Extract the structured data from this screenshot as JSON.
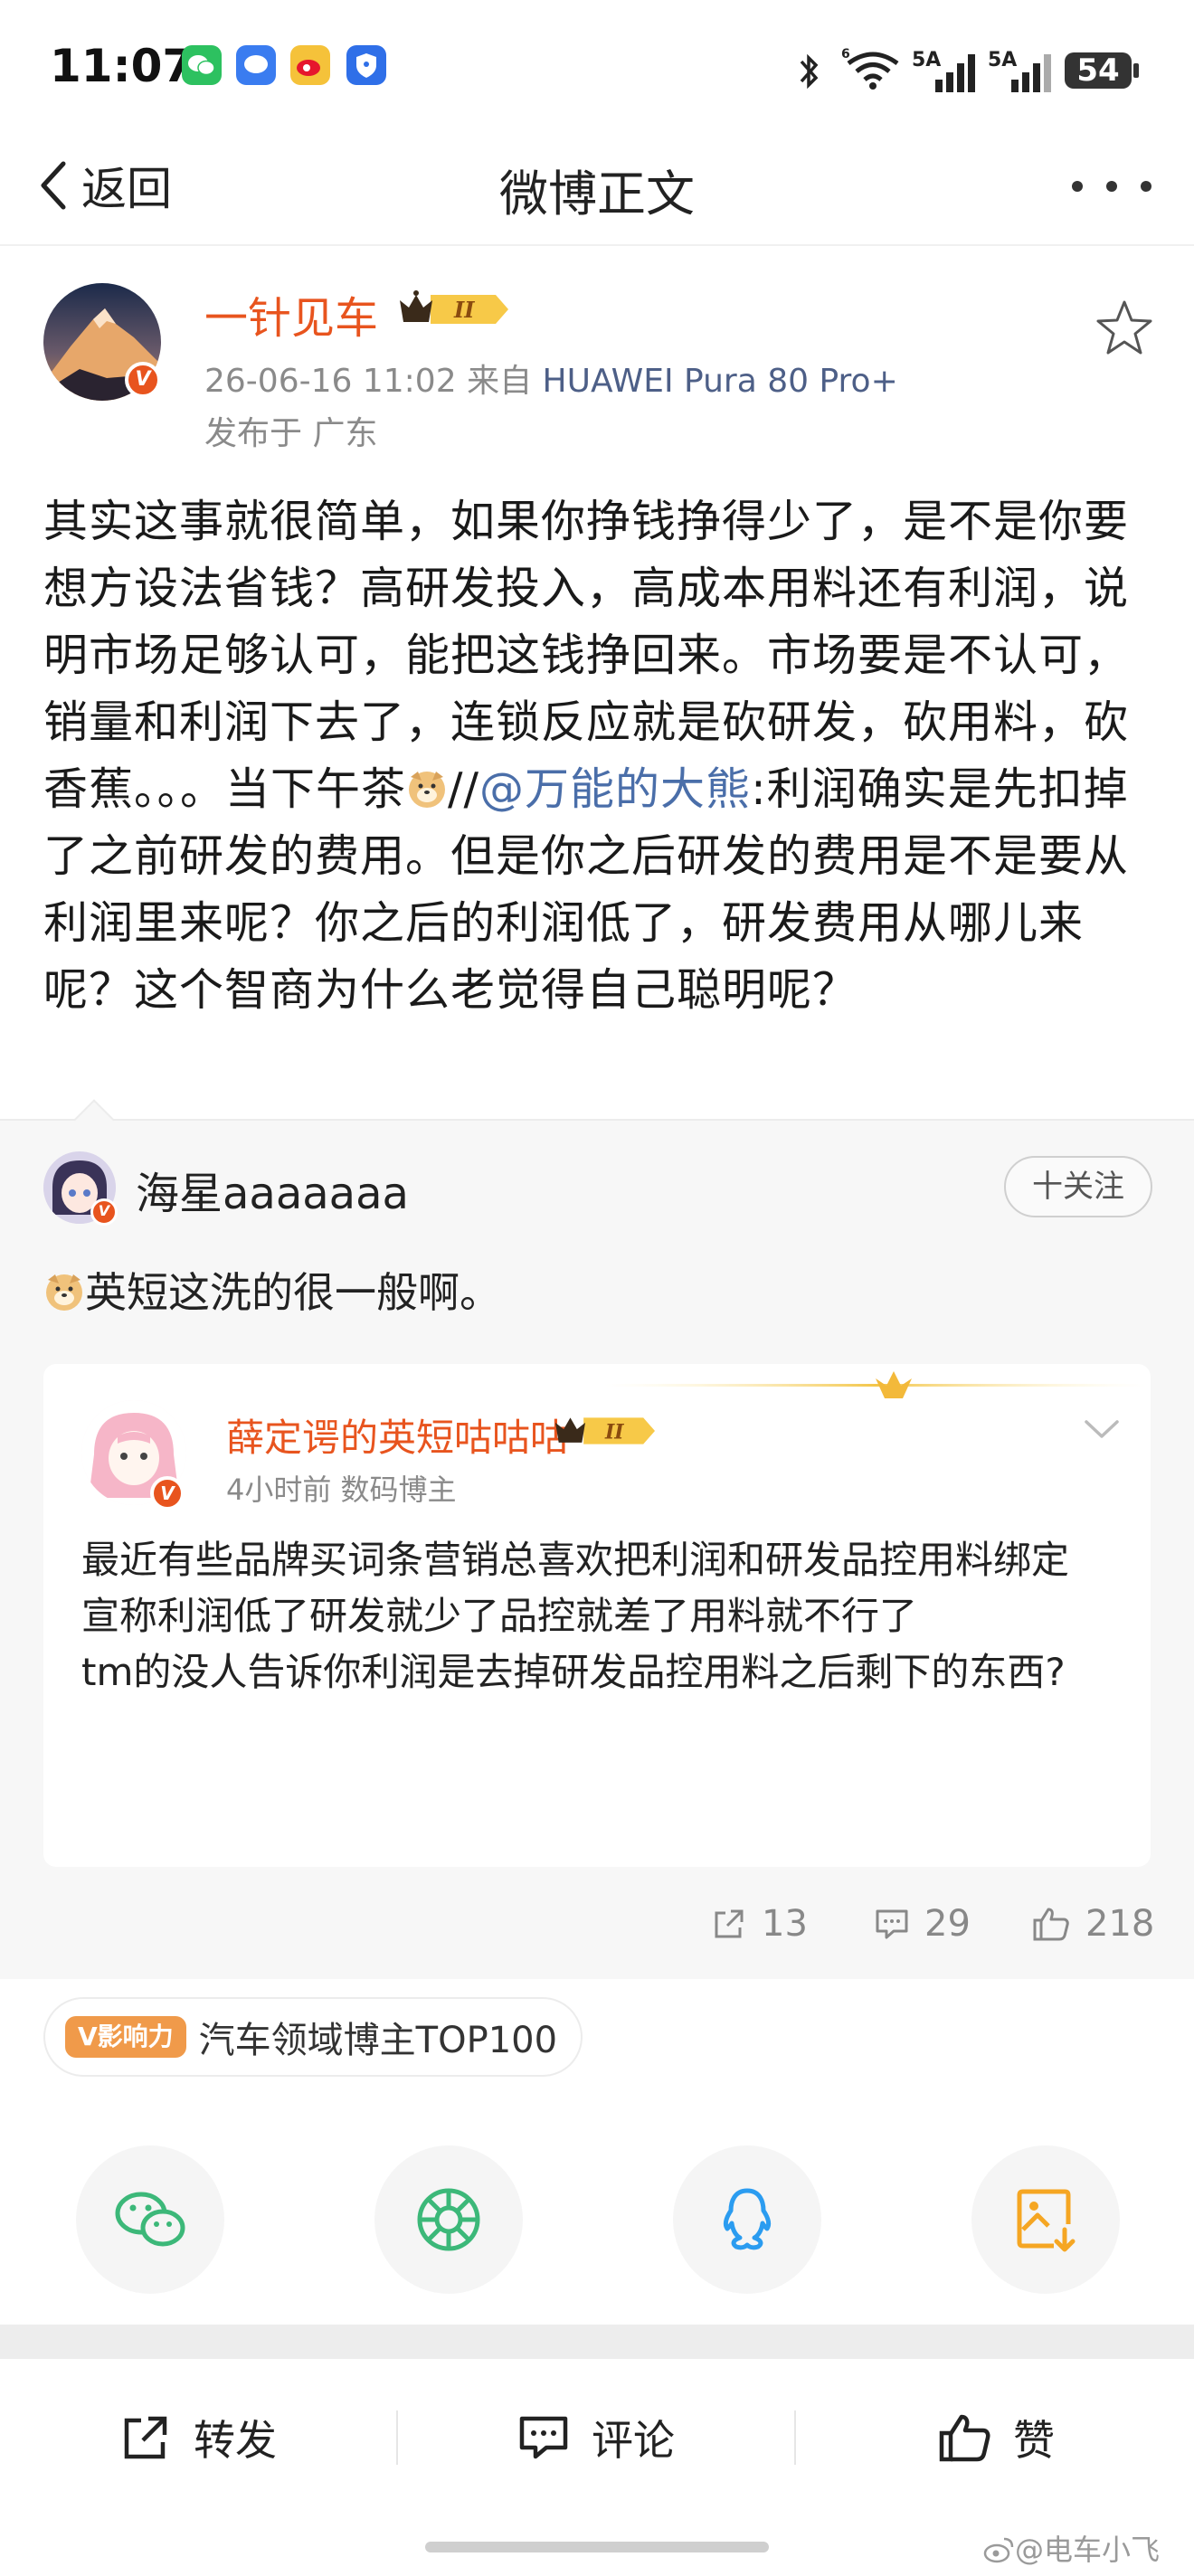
{
  "status_bar": {
    "time": "11:07",
    "battery": "54",
    "signal_1": "5A",
    "signal_2": "5A",
    "wifi_badge": "6"
  },
  "nav": {
    "back_label": "返回",
    "title": "微博正文"
  },
  "post": {
    "author": "一针见车",
    "level_badge": "II",
    "time": "26-06-16 11:02",
    "source_prefix": "来自",
    "device": "HUAWEI Pura 80 Pro+",
    "location": "发布于 广东",
    "text_1": "其实这事就很简单，如果你挣钱挣得少了，是不是你要想方设法省钱？高研发投入，高成本用料还有利润，说明市场足够认可，能把这钱挣回来。市场要是不认可，销量和利润下去了，连锁反应就是砍研发，砍用料，砍香蕉。。。当下午茶",
    "text_sep": "//",
    "mention": "@万能的大熊",
    "text_2": ":利润确实是先扣掉了之前研发的费用。但是你之后研发的费用是不是要从利润里来呢？你之后的利润低了，研发费用从哪儿来呢？这个智商为什么老觉得自己聪明呢？"
  },
  "repost": {
    "commenter": "海星aaaaaaa",
    "follow_label": "十关注",
    "comment": "英短这洗的很一般啊。",
    "card": {
      "author": "薛定谔的英短咕咕咕",
      "level_badge": "II",
      "time": "4小时前",
      "tag": "数码博主",
      "lines": [
        "最近有些品牌买词条营销总喜欢把利润和研发品控用料绑定",
        "宣称利润低了研发就少了品控就差了用料就不行了",
        "tm的没人告诉你利润是去掉研发品控用料之后剩下的东西?"
      ]
    },
    "counts": {
      "reposts": "13",
      "comments": "29",
      "likes": "218"
    }
  },
  "influence": {
    "tag": "V影响力",
    "text": "汽车领域博主TOP100"
  },
  "share": [
    "wechat-icon",
    "moments-icon",
    "qq-icon",
    "save-image-icon"
  ],
  "toolbar": {
    "repost": "转发",
    "comment": "评论",
    "like": "赞"
  },
  "watermark": "@电车小飞",
  "colors": {
    "author_orange": "#e8541e",
    "link_blue": "#4a6ea9",
    "wechat_green": "#3cb879",
    "qq_blue": "#2b9cf0",
    "save_orange": "#f5a623"
  }
}
